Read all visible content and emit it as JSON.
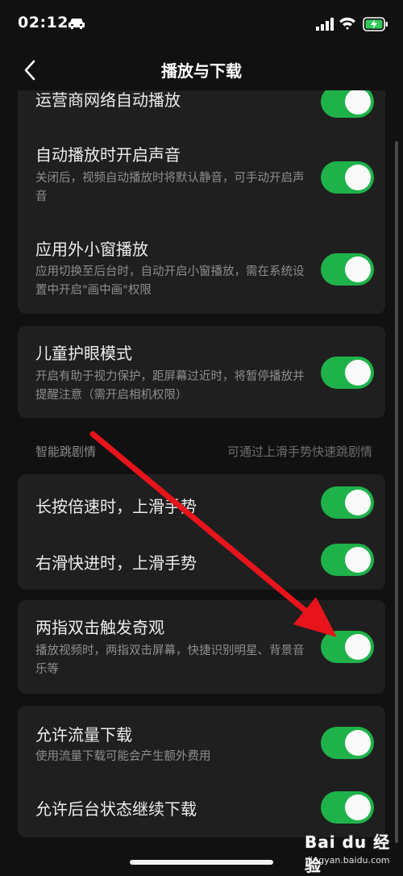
{
  "status": {
    "time": "02:12"
  },
  "nav": {
    "title": "播放与下载"
  },
  "cards": [
    {
      "rows": [
        {
          "title": "运营商网络自动播放",
          "desc": "",
          "on": true
        },
        {
          "title": "自动播放时开启声音",
          "desc": "关闭后，视频自动播放时将默认静音，可手动开启声音",
          "on": true
        },
        {
          "title": "应用外小窗播放",
          "desc": "应用切换至后台时，自动开启小窗播放，需在系统设置中开启\"画中画\"权限",
          "on": true
        }
      ]
    },
    {
      "rows": [
        {
          "title": "儿童护眼模式",
          "desc": "开启有助于视力保护，距屏幕过近时，将暂停播放并提醒注意（需开启相机权限）",
          "on": true
        }
      ]
    },
    {
      "rows": [
        {
          "title": "长按倍速时，上滑手势",
          "desc": "",
          "on": true
        },
        {
          "title": "右滑快进时，上滑手势",
          "desc": "",
          "on": true
        }
      ]
    },
    {
      "rows": [
        {
          "title": "两指双击触发奇观",
          "desc": "播放视频时，两指双击屏幕，快捷识别明星、背景音乐等",
          "on": true
        }
      ]
    },
    {
      "rows": [
        {
          "title": "允许流量下载",
          "desc": "使用流量下载可能会产生额外费用",
          "on": true
        },
        {
          "title": "允许后台状态继续下载",
          "desc": "",
          "on": true
        }
      ]
    }
  ],
  "section": {
    "label": "智能跳剧情",
    "hint": "可通过上滑手势快速跳剧情"
  },
  "watermark": {
    "text": "Bai du 经验",
    "url": "jingyan.baidu.com"
  },
  "colors": {
    "toggle_on": "#1fb24a",
    "card_bg": "#1f1f1f",
    "page_bg": "#111111",
    "arrow": "#e8141c"
  }
}
